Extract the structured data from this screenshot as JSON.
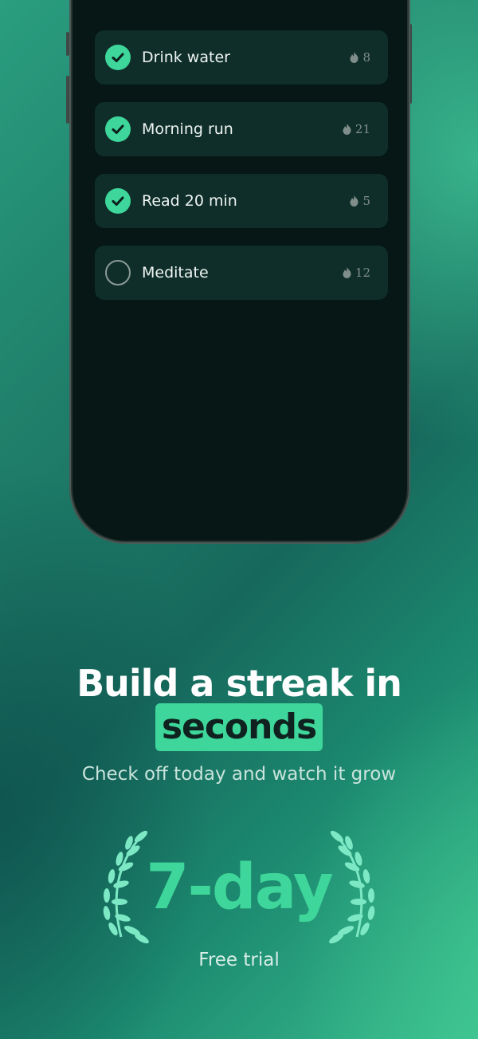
{
  "habits": [
    {
      "label": "Drink water",
      "streak": "8",
      "done": true
    },
    {
      "label": "Morning run",
      "streak": "21",
      "done": true
    },
    {
      "label": "Read 20 min",
      "streak": "5",
      "done": true
    },
    {
      "label": "Meditate",
      "streak": "12",
      "done": false
    }
  ],
  "promo": {
    "headline": "Build a streak in",
    "highlight": "seconds",
    "subtitle": "Check off today and watch it grow",
    "trial_length": "7-day",
    "trial_label": "Free trial"
  },
  "icons": {
    "check": "check-circle-icon",
    "empty": "empty-circle-icon",
    "streak": "flame-icon",
    "laurel": "laurel-wreath-icon"
  },
  "colors": {
    "accent": "#3ed69a",
    "card": "#0f2e29",
    "screen": "#061715"
  }
}
